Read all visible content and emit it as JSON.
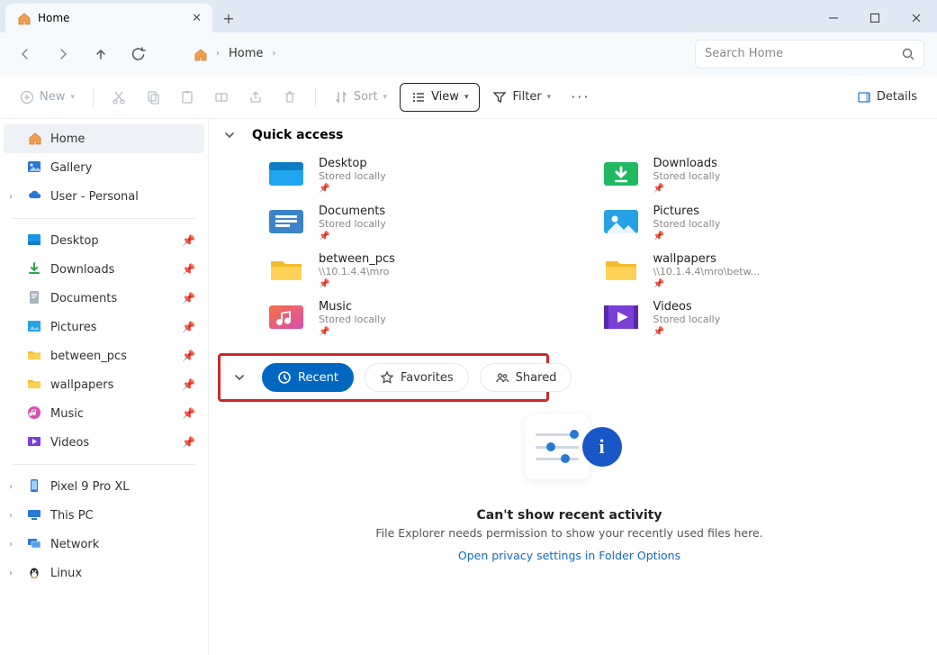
{
  "window": {
    "tab_title": "Home",
    "new_tab_tooltip": "+"
  },
  "address": {
    "breadcrumb": "Home",
    "search_placeholder": "Search Home"
  },
  "toolbar": {
    "new": "New",
    "sort": "Sort",
    "view": "View",
    "filter": "Filter",
    "details": "Details"
  },
  "sidebar": {
    "primary": [
      {
        "label": "Home",
        "icon": "home",
        "active": true
      },
      {
        "label": "Gallery",
        "icon": "gallery"
      },
      {
        "label": "User - Personal",
        "icon": "onedrive",
        "expandable": true
      }
    ],
    "pinned": [
      {
        "label": "Desktop",
        "icon": "desktop"
      },
      {
        "label": "Downloads",
        "icon": "downloads"
      },
      {
        "label": "Documents",
        "icon": "documents"
      },
      {
        "label": "Pictures",
        "icon": "pictures"
      },
      {
        "label": "between_pcs",
        "icon": "folder"
      },
      {
        "label": "wallpapers",
        "icon": "folder"
      },
      {
        "label": "Music",
        "icon": "music"
      },
      {
        "label": "Videos",
        "icon": "videos"
      }
    ],
    "system": [
      {
        "label": "Pixel 9 Pro XL",
        "icon": "phone"
      },
      {
        "label": "This PC",
        "icon": "pc"
      },
      {
        "label": "Network",
        "icon": "network"
      },
      {
        "label": "Linux",
        "icon": "linux"
      }
    ]
  },
  "quick_access": {
    "title": "Quick access",
    "items": [
      {
        "name": "Desktop",
        "sub": "Stored locally",
        "icon": "desktop-folder"
      },
      {
        "name": "Downloads",
        "sub": "Stored locally",
        "icon": "downloads-folder"
      },
      {
        "name": "Documents",
        "sub": "Stored locally",
        "icon": "documents-folder"
      },
      {
        "name": "Pictures",
        "sub": "Stored locally",
        "icon": "pictures-folder"
      },
      {
        "name": "between_pcs",
        "sub": "\\\\10.1.4.4\\mro",
        "icon": "folder"
      },
      {
        "name": "wallpapers",
        "sub": "\\\\10.1.4.4\\mro\\betw...",
        "icon": "folder"
      },
      {
        "name": "Music",
        "sub": "Stored locally",
        "icon": "music-folder"
      },
      {
        "name": "Videos",
        "sub": "Stored locally",
        "icon": "videos-folder"
      }
    ]
  },
  "chips": {
    "recent": "Recent",
    "favorites": "Favorites",
    "shared": "Shared"
  },
  "empty": {
    "title": "Can't show recent activity",
    "text": "File Explorer needs permission to show your recently used files here.",
    "link": "Open privacy settings in Folder Options"
  },
  "colors": {
    "accent": "#0067c0"
  }
}
